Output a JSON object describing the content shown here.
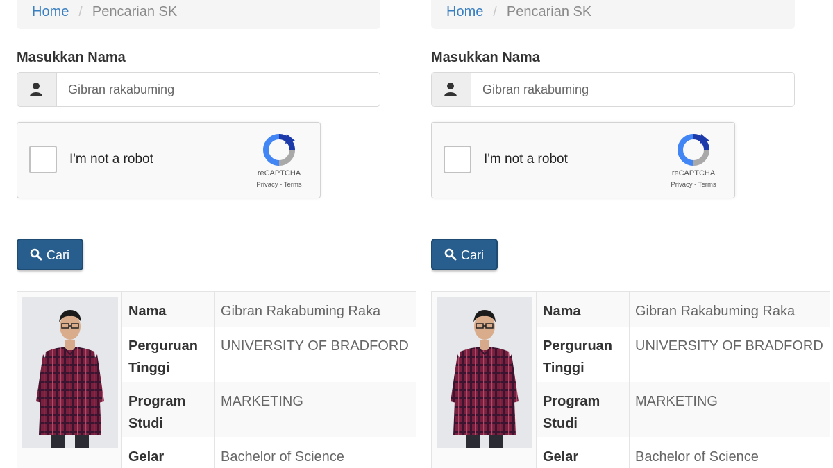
{
  "panels": [
    {
      "breadcrumb": {
        "home": "Home",
        "separator": "/",
        "current": "Pencarian SK"
      },
      "search": {
        "label": "Masukkan Nama",
        "value": "Gibran rakabuming"
      },
      "captcha": {
        "text": "I'm not a robot",
        "brand": "reCAPTCHA",
        "links": "Privacy - Terms"
      },
      "search_button": {
        "label": "Cari",
        "icon": "search-icon"
      },
      "result": {
        "nama_label": "Nama",
        "nama_value": "Gibran Rakabuming Raka",
        "pt_label": "Perguruan Tinggi",
        "pt_value": "UNIVERSITY OF BRADFORD",
        "prodi_label": "Program Studi",
        "prodi_value": "MARKETING",
        "gelar_label": "Gelar",
        "gelar_value": "Bachelor of Science"
      }
    },
    {
      "breadcrumb": {
        "home": "Home",
        "separator": "/",
        "current": "Pencarian SK"
      },
      "search": {
        "label": "Masukkan Nama",
        "value": "Gibran rakabuming"
      },
      "captcha": {
        "text": "I'm not a robot",
        "brand": "reCAPTCHA",
        "links": "Privacy - Terms"
      },
      "search_button": {
        "label": "Cari",
        "icon": "search-icon"
      },
      "result": {
        "nama_label": "Nama",
        "nama_value": "Gibran Rakabuming Raka",
        "pt_label": "Perguruan Tinggi",
        "pt_value": "UNIVERSITY OF BRADFORD",
        "prodi_label": "Program Studi",
        "prodi_value": "MARKETING",
        "gelar_label": "Gelar",
        "gelar_value": "Bachelor of Science"
      }
    }
  ],
  "colors": {
    "link": "#3a7fc0",
    "button": "#285e8e",
    "shirt": "#7a1f3d"
  }
}
